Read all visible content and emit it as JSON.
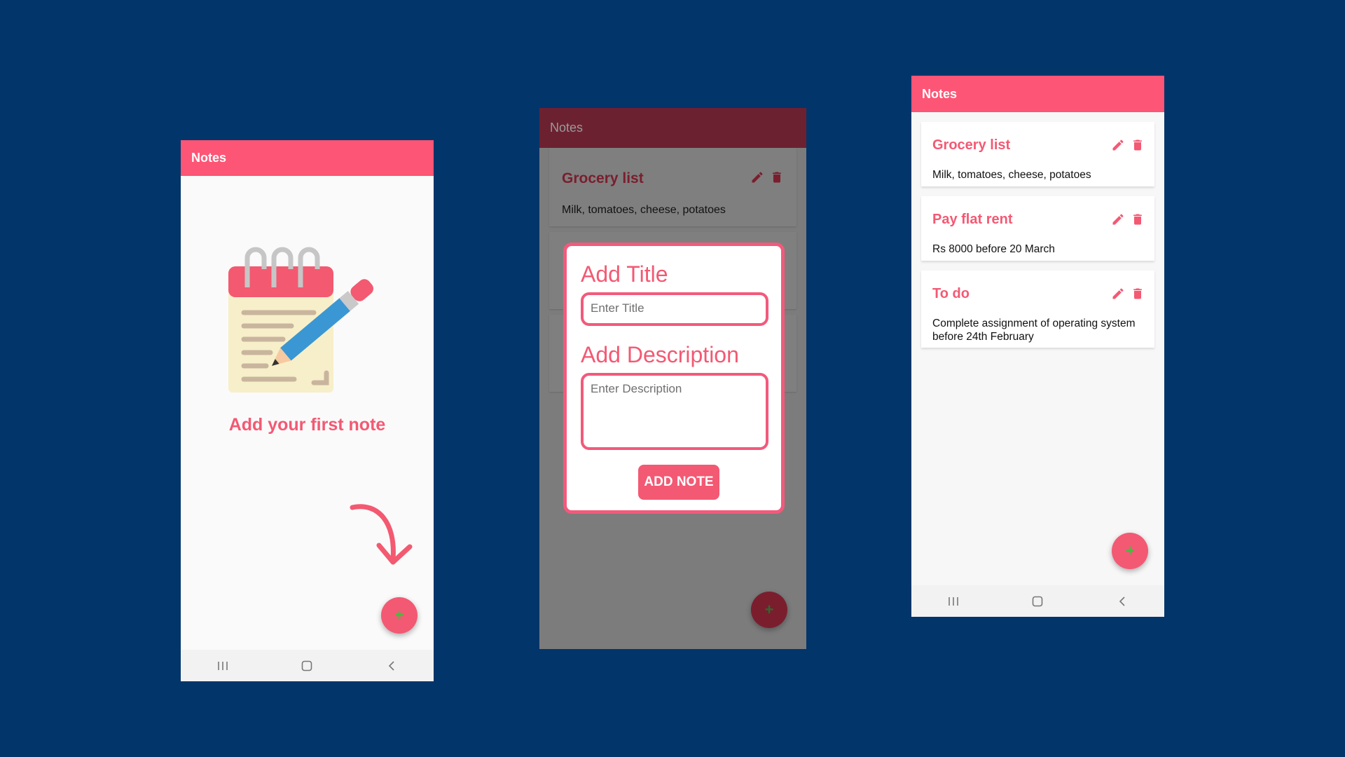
{
  "colors": {
    "background": "#02356a",
    "accent": "#fd5575",
    "accent_dim": "#7a1e2e",
    "fab_plus": "#3fbf3f"
  },
  "phone1": {
    "app_title": "Notes",
    "empty_message": "Add your first note",
    "fab_label": "+"
  },
  "phone2": {
    "app_title": "Notes",
    "background_note": {
      "title": "Grocery list",
      "description": "Milk, tomatoes, cheese, potatoes"
    },
    "dialog": {
      "title_label": "Add Title",
      "title_placeholder": "Enter Title",
      "description_label": "Add Description",
      "description_placeholder": "Enter Description",
      "submit_label": "ADD NOTE"
    },
    "fab_label": "+"
  },
  "phone3": {
    "app_title": "Notes",
    "notes": [
      {
        "title": "Grocery list",
        "description": "Milk, tomatoes, cheese, potatoes"
      },
      {
        "title": "Pay flat rent",
        "description": "Rs 8000 before 20 March"
      },
      {
        "title": "To do",
        "description": "Complete assignment of operating system before 24th February"
      }
    ],
    "fab_label": "+"
  },
  "icons": {
    "edit": "pencil-icon",
    "delete": "trash-icon",
    "nav_recent": "recent-apps-icon",
    "nav_home": "home-icon",
    "nav_back": "back-icon"
  }
}
